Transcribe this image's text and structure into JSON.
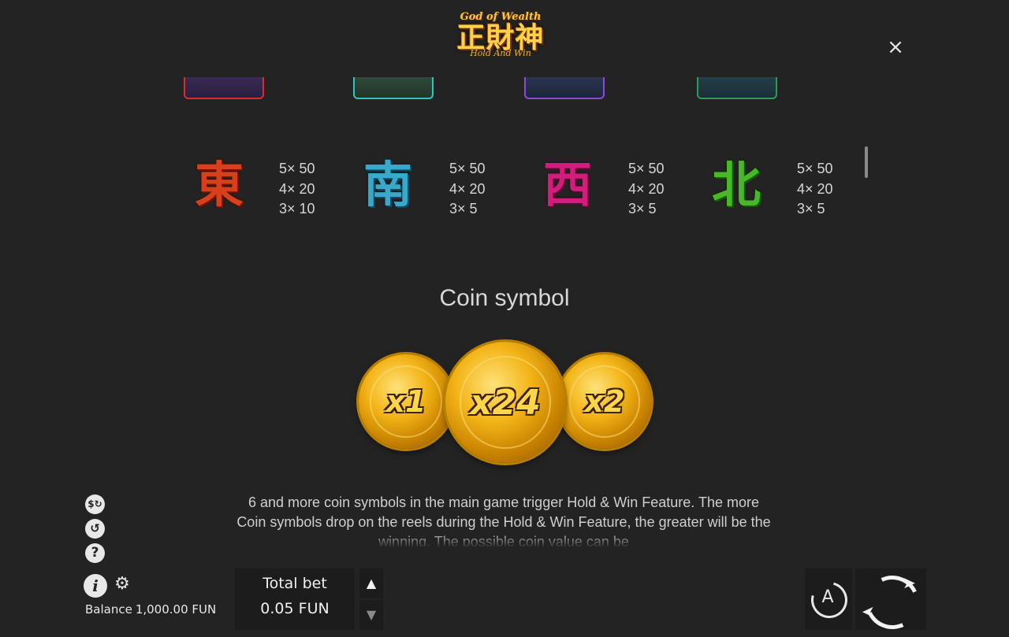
{
  "header": {
    "logo_top": "God of Wealth",
    "logo_main": "正財神",
    "logo_sub": "Hold And Win",
    "close_glyph": "×"
  },
  "paytable": [
    {
      "symbol": "東",
      "color": "#d8401c",
      "payouts": [
        "5× 50",
        "4× 20",
        "3× 10"
      ]
    },
    {
      "symbol": "南",
      "color": "#3aa8c8",
      "payouts": [
        "5× 50",
        "4× 20",
        "3× 5"
      ]
    },
    {
      "symbol": "西",
      "color": "#d21d7c",
      "payouts": [
        "5× 50",
        "4× 20",
        "3× 5"
      ]
    },
    {
      "symbol": "北",
      "color": "#48b728",
      "payouts": [
        "5× 50",
        "4× 20",
        "3× 5"
      ]
    }
  ],
  "coin_section": {
    "title": "Coin symbol",
    "coins": [
      "x1",
      "x24",
      "x2"
    ],
    "description": "6 and more coin symbols in the main game trigger Hold & Win Feature. The more Coin symbols drop on the reels during the Hold & Win Feature, the greater will be the winning. The possible coin value can be"
  },
  "sidebar": {
    "icons": [
      "gamble-icon",
      "history-icon",
      "help-icon",
      "info-icon",
      "settings-icon"
    ]
  },
  "footer": {
    "balance_label": "Balance",
    "balance_value": "1,000.00 FUN",
    "total_bet_label": "Total bet",
    "total_bet_value": "0.05 FUN",
    "auto_letter": "A"
  }
}
